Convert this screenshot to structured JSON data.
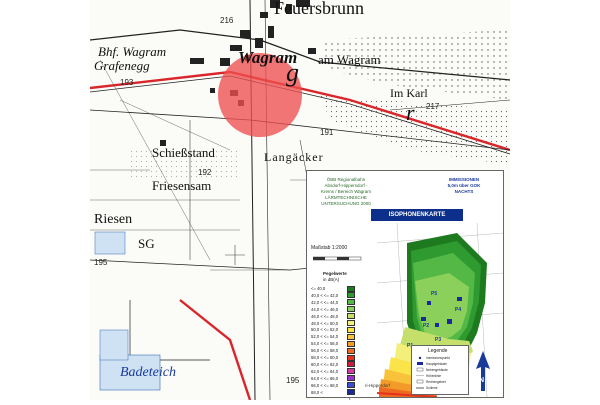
{
  "map": {
    "places": {
      "feuersbrunn": "Feuersbrunn",
      "bhf_wagram": "Bhf. Wagram",
      "grafenegg": "Grafenegg",
      "wagram": "Wagram",
      "am_wagram": "am Wagram",
      "im_karl": "Im Karl",
      "schiessstand": "Schießstand",
      "langacker": "Langäcker",
      "friesensam": "Friesensam",
      "riesen": "Riesen",
      "sg": "SG",
      "badeteich": "Badeteich",
      "g_letter": "g",
      "r_letter": "r"
    },
    "spot_heights": {
      "h216": "216",
      "h193": "193",
      "h217": "217",
      "h191": "191",
      "h192": "192",
      "h195": "195",
      "h195b": "195"
    }
  },
  "inset": {
    "info_lines": [
      "ÖBB Regionalbahn",
      "Absdorf-Hippersdorf -",
      "Krems / Bereich Wagram",
      "LÄRMTECHNISCHE",
      "UNTERSUCHUNG 2000"
    ],
    "immission_lines": [
      "IMMISSIONEN",
      "5,0m über GOK",
      "NACHTS"
    ],
    "title": "ISOPHONENKARTE",
    "scale_label": "Maßstab 1:2000",
    "legend_heading_1": "Pegelwerte",
    "legend_heading_2": "in dB(A)",
    "legend_rows": [
      {
        "label": "<= 40,0",
        "color": "#1e7a1e"
      },
      {
        "label": "40,0 <  <= 42,0",
        "color": "#2f9a2f"
      },
      {
        "label": "42,0 <  <= 44,0",
        "color": "#53b845"
      },
      {
        "label": "44,0 <  <= 46,0",
        "color": "#8bd05a"
      },
      {
        "label": "46,0 <  <= 48,0",
        "color": "#c5e06a"
      },
      {
        "label": "48,0 <  <= 50,0",
        "color": "#f2ef7a"
      },
      {
        "label": "50,0 <  <= 52,0",
        "color": "#fbe34a"
      },
      {
        "label": "52,0 <  <= 54,0",
        "color": "#f8c23a"
      },
      {
        "label": "54,0 <  <= 56,0",
        "color": "#f39a2a"
      },
      {
        "label": "56,0 <  <= 58,0",
        "color": "#ee6a22"
      },
      {
        "label": "58,0 <  <= 60,0",
        "color": "#e2321e"
      },
      {
        "label": "60,0 <  <= 62,0",
        "color": "#c81e3c"
      },
      {
        "label": "62,0 <  <= 64,0",
        "color": "#d23ca0"
      },
      {
        "label": "64,0 <  <= 66,0",
        "color": "#9a32c8"
      },
      {
        "label": "66,0 <  <= 68,0",
        "color": "#3c4ad2"
      },
      {
        "label": "68,0 <",
        "color": "#1a2a9a"
      }
    ],
    "point_labels": [
      "P1",
      "P2",
      "P3",
      "P4",
      "P5"
    ],
    "legend_box_title": "Legende",
    "legend_items": [
      "Immissionspunkt",
      "Hauptgebäude",
      "Nebengebäude",
      "Höhenlinie",
      "Rechengebiet",
      "Schiene"
    ],
    "north_label": "N",
    "rail_label": "ri-Hipperdorf"
  },
  "colors": {
    "rail_red": "#d9262a",
    "marker_red": "#f05050",
    "title_blue": "#0b2f8a"
  }
}
